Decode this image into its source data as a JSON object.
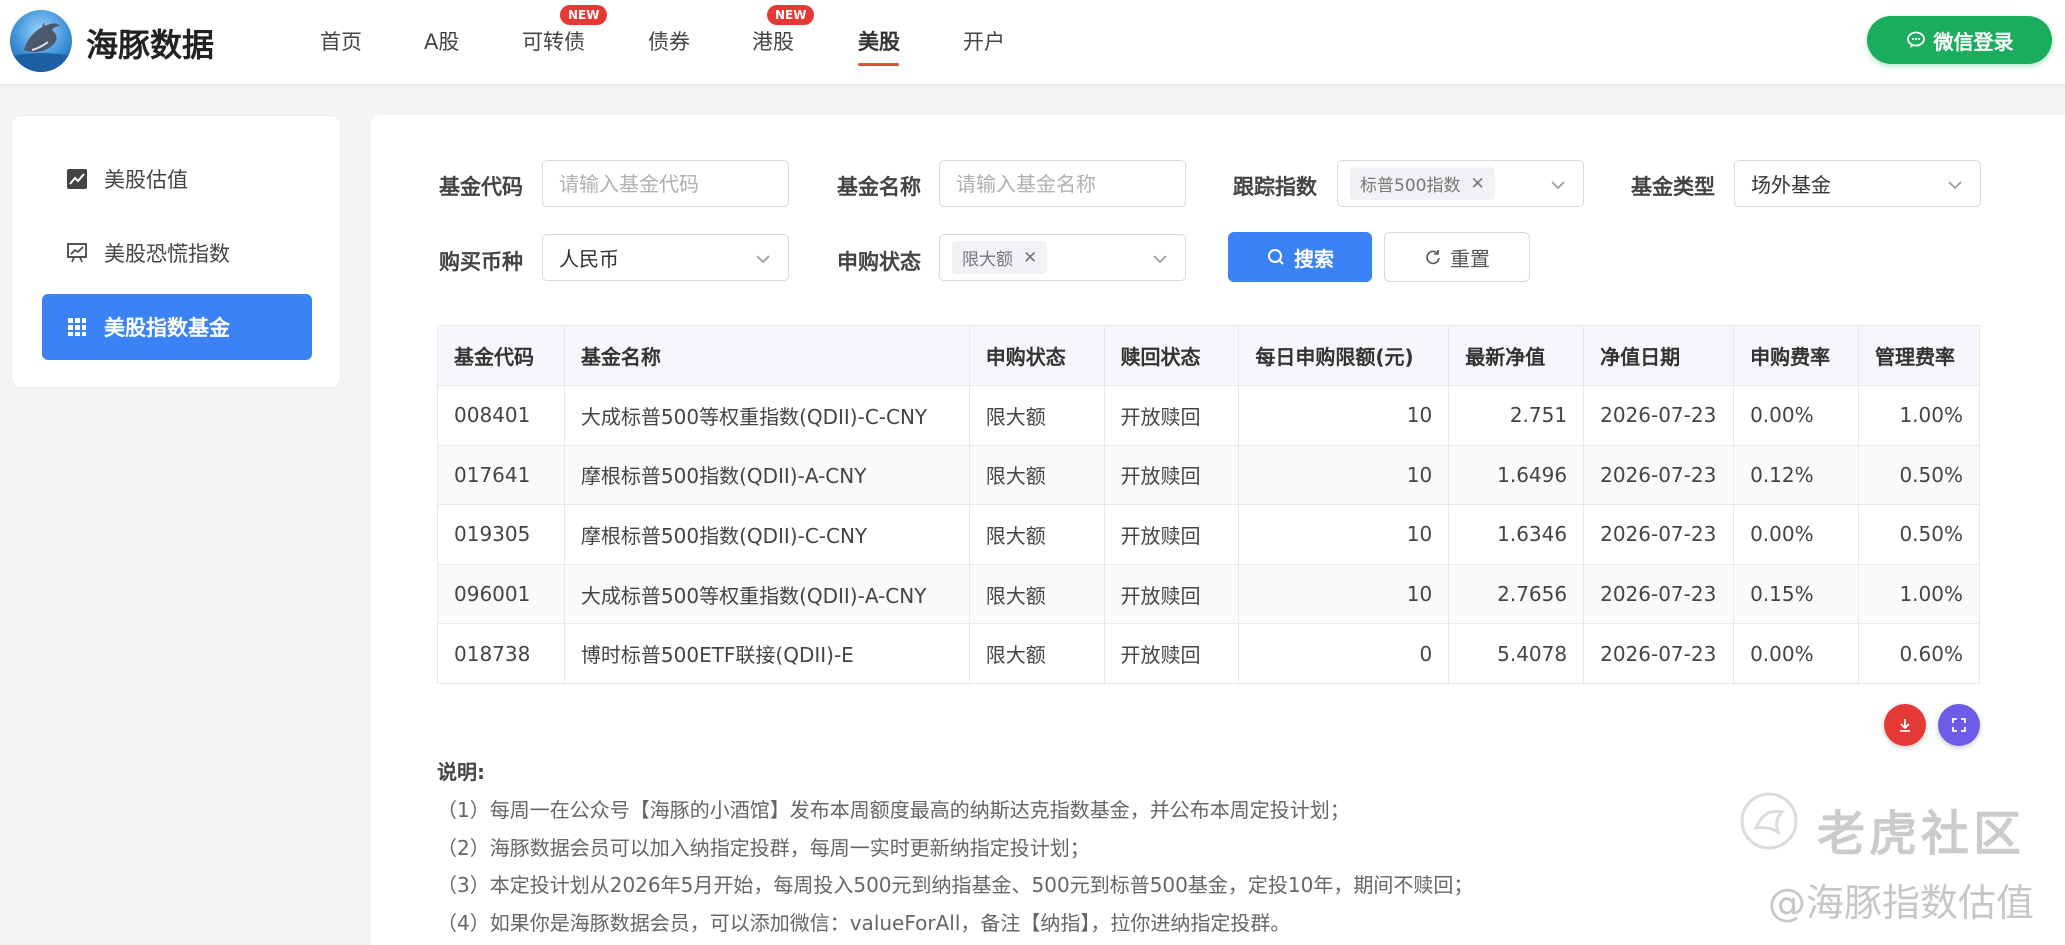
{
  "header": {
    "brand": "海豚数据",
    "nav": [
      {
        "label": "首页",
        "badge": ""
      },
      {
        "label": "A股",
        "badge": ""
      },
      {
        "label": "可转债",
        "badge": "NEW"
      },
      {
        "label": "债券",
        "badge": ""
      },
      {
        "label": "港股",
        "badge": "NEW"
      },
      {
        "label": "美股",
        "badge": ""
      },
      {
        "label": "开户",
        "badge": ""
      }
    ],
    "active_nav": "美股",
    "login_label": "微信登录",
    "accent": "#e74c3c",
    "login_color": "#1aad5b"
  },
  "sidebar": {
    "items": [
      {
        "label": "美股估值",
        "icon": "chart-line-icon"
      },
      {
        "label": "美股恐慌指数",
        "icon": "presentation-chart-icon"
      },
      {
        "label": "美股指数基金",
        "icon": "grid-icon"
      }
    ],
    "active": "美股指数基金",
    "active_color": "#3b82f6"
  },
  "filters": {
    "fund_code": {
      "label": "基金代码",
      "placeholder": "请输入基金代码"
    },
    "fund_name": {
      "label": "基金名称",
      "placeholder": "请输入基金名称"
    },
    "tracking_index": {
      "label": "跟踪指数",
      "tag": "标普500指数"
    },
    "fund_type": {
      "label": "基金类型",
      "value": "场外基金"
    },
    "currency": {
      "label": "购买币种",
      "value": "人民币"
    },
    "purchase_status": {
      "label": "申购状态",
      "tag": "限大额"
    },
    "search_label": "搜索",
    "reset_label": "重置"
  },
  "table": {
    "columns": [
      "基金代码",
      "基金名称",
      "申购状态",
      "赎回状态",
      "每日申购限额(元)",
      "最新净值",
      "净值日期",
      "申购费率",
      "管理费率"
    ],
    "rows": [
      [
        "008401",
        "大成标普500等权重指数(QDII)-C-CNY",
        "限大额",
        "开放赎回",
        "10",
        "2.751",
        "2026-07-23",
        "0.00%",
        "1.00%"
      ],
      [
        "017641",
        "摩根标普500指数(QDII)-A-CNY",
        "限大额",
        "开放赎回",
        "10",
        "1.6496",
        "2026-07-23",
        "0.12%",
        "0.50%"
      ],
      [
        "019305",
        "摩根标普500指数(QDII)-C-CNY",
        "限大额",
        "开放赎回",
        "10",
        "1.6346",
        "2026-07-23",
        "0.00%",
        "0.50%"
      ],
      [
        "096001",
        "大成标普500等权重指数(QDII)-A-CNY",
        "限大额",
        "开放赎回",
        "10",
        "2.7656",
        "2026-07-23",
        "0.15%",
        "1.00%"
      ],
      [
        "018738",
        "博时标普500ETF联接(QDII)-E",
        "限大额",
        "开放赎回",
        "0",
        "5.4078",
        "2026-07-23",
        "0.00%",
        "0.60%"
      ]
    ]
  },
  "fabs": {
    "download_color": "#e53935",
    "fullscreen_color": "#6c5ce7"
  },
  "notes": {
    "title": "说明:",
    "items": [
      "（1）每周一在公众号【海豚的小酒馆】发布本周额度最高的纳斯达克指数基金，并公布本周定投计划；",
      "（2）海豚数据会员可以加入纳指定投群，每周一实时更新纳指定投计划；",
      "（3）本定投计划从2026年5月开始，每周投入500元到纳指基金、500元到标普500基金，定投10年，期间不赎回；",
      "（4）如果你是海豚数据会员，可以添加微信：valueForAll，备注【纳指】，拉你进纳指定投群。"
    ]
  },
  "watermark": {
    "line1": "老虎社区",
    "line2": "@海豚指数估值"
  }
}
